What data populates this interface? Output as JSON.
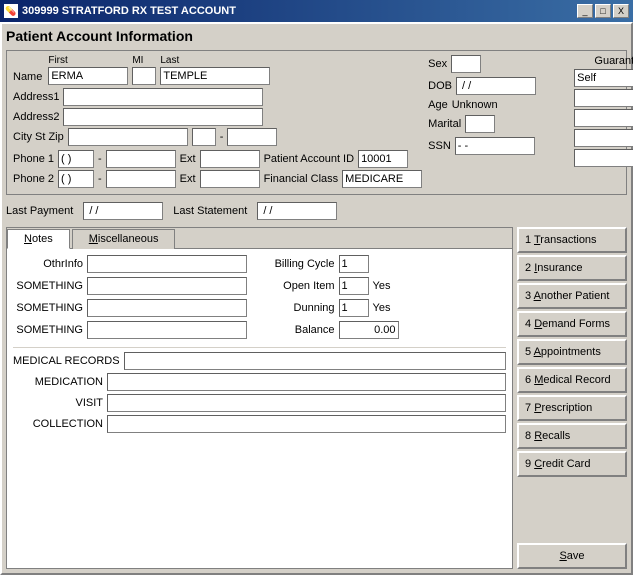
{
  "titleBar": {
    "icon": "Rx",
    "title": "309999 STRATFORD RX TEST ACCOUNT",
    "buttons": {
      "minimize": "_",
      "maximize": "□",
      "close": "X"
    }
  },
  "pageTitle": "Patient Account Information",
  "patientInfo": {
    "labels": {
      "name": "Name",
      "first": "First",
      "mi": "MI",
      "last": "Last",
      "address1": "Address1",
      "address2": "Address2",
      "cityStZip": "City St Zip",
      "sex": "Sex",
      "dob": "DOB",
      "age": "Age",
      "marital": "Marital",
      "ssn": "SSN",
      "phone1": "Phone 1",
      "phone2": "Phone 2",
      "ext": "Ext",
      "patientAccountId": "Patient Account ID",
      "financialClass": "Financial Class"
    },
    "values": {
      "firstName": "ERMA",
      "mi": "",
      "lastName": "TEMPLE",
      "address1": "",
      "address2": "",
      "city": "",
      "state": "",
      "zip": "",
      "sex": "",
      "dobSlash1": "/",
      "dobSlash2": "/",
      "dobValue": " / /",
      "ageValue": "Unknown",
      "marital": "",
      "ssnDash": "- -",
      "phone1Area": "( )",
      "phone1": "-",
      "phone1Ext": "",
      "phone2Area": "( )",
      "phone2": "-",
      "phone2Ext": "",
      "patientAccountId": "10001",
      "financialClass": "MEDICARE"
    },
    "guarantor": {
      "label": "Guarantor",
      "self": "Self",
      "rows": [
        "",
        "",
        "",
        ""
      ]
    }
  },
  "paymentRow": {
    "lastPaymentLabel": "Last Payment",
    "lastPaymentValue": " / /",
    "lastStatementLabel": "Last Statement",
    "lastStatementValue": " / /"
  },
  "tabs": {
    "items": [
      {
        "id": "notes",
        "label": "Notes",
        "underline": "N",
        "active": true
      },
      {
        "id": "miscellaneous",
        "label": "Miscellaneous",
        "underline": "M",
        "active": false
      }
    ]
  },
  "notesTab": {
    "left": {
      "fields": [
        {
          "label": "OthrInfo",
          "value": ""
        },
        {
          "label": "SOMETHING",
          "value": ""
        },
        {
          "label": "SOMETHING",
          "value": ""
        },
        {
          "label": "SOMETHING",
          "value": ""
        }
      ]
    },
    "right": {
      "billingCycleLabel": "Billing Cycle",
      "billingCycleValue": "1",
      "openItemLabel": "Open Item",
      "openItemValue": "1",
      "openItemYes": "Yes",
      "dunningLabel": "Dunning",
      "dunningValue": "1",
      "dunningYes": "Yes",
      "balanceLabel": "Balance",
      "balanceValue": "0.00"
    },
    "records": [
      {
        "label": "MEDICAL RECORDS",
        "value": ""
      },
      {
        "label": "MEDICATION",
        "value": ""
      },
      {
        "label": "VISIT",
        "value": ""
      },
      {
        "label": "COLLECTION",
        "value": ""
      }
    ]
  },
  "rightButtons": [
    {
      "id": "transactions",
      "label": "1 Transactions",
      "underlineChar": "T"
    },
    {
      "id": "insurance",
      "label": "2 Insurance",
      "underlineChar": "I"
    },
    {
      "id": "another-patient",
      "label": "3 Another Patient",
      "underlineChar": "A"
    },
    {
      "id": "demand-forms",
      "label": "4 Demand Forms",
      "underlineChar": "D"
    },
    {
      "id": "appointments",
      "label": "5 Appointments",
      "underlineChar": "A"
    },
    {
      "id": "medical-record",
      "label": "6 Medical Record",
      "underlineChar": "M"
    },
    {
      "id": "prescription",
      "label": "7 Prescription",
      "underlineChar": "P"
    },
    {
      "id": "recalls",
      "label": "8 Recalls",
      "underlineChar": "R"
    },
    {
      "id": "credit-card",
      "label": "9 Credit Card",
      "underlineChar": "C"
    }
  ],
  "saveButton": {
    "label": "Save",
    "underlineChar": "S"
  }
}
